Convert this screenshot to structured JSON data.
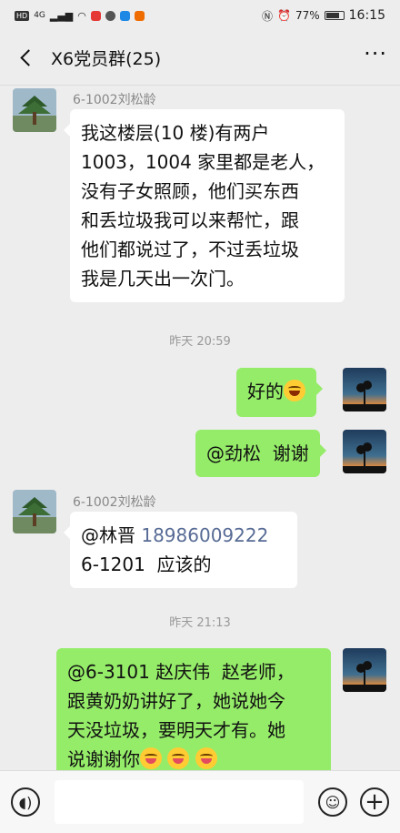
{
  "status_bar": {
    "battery": "77%",
    "time": "16:15",
    "network": "4G"
  },
  "header": {
    "title": "X6党员群(25)"
  },
  "messages": [
    {
      "sender": "6-1002刘松龄",
      "lines": [
        "我这楼层(10 楼)有两户",
        "1003，1004 家里都是老人，",
        "没有子女照顾，他们买东西",
        "和丢垃圾我可以来帮忙，跟",
        "他们都说过了，不过丢垃圾",
        "我是几天出一次门。"
      ]
    },
    {
      "time": "昨天 20:59"
    },
    {
      "text": "好的"
    },
    {
      "text": "@劲松  谢谢"
    },
    {
      "sender": "6-1002刘松龄",
      "line1_prefix": "@林晋 ",
      "phone": "18986009222",
      "line2": "6-1201  应该的"
    },
    {
      "time": "昨天 21:13"
    },
    {
      "lines": [
        "@6-3101 赵庆伟  赵老师，",
        "跟黄奶奶讲好了，她说她今",
        "天没垃圾，要明天才有。她",
        "说谢谢你"
      ]
    }
  ]
}
